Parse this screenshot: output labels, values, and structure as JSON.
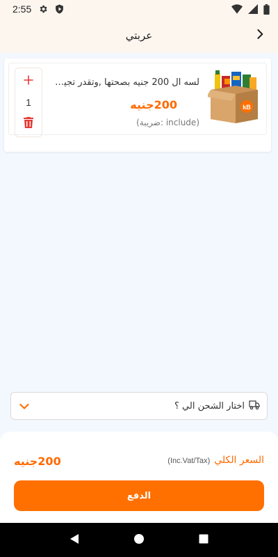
{
  "status_bar": {
    "time": "2:55",
    "icons": [
      "settings-icon",
      "shield-play-icon",
      "wifi-icon",
      "signal-icon",
      "battery-icon"
    ]
  },
  "app_bar": {
    "title": "عربتي",
    "back_icon": "chevron-right-icon"
  },
  "cart": {
    "items": [
      {
        "name": "لسه ال 200 جنيه بصحتها ,وتقدر تجيب...",
        "price": "200جنيه",
        "tax": "(include :ضريبة)",
        "quantity": "1",
        "image_icon": "grocery-box-image"
      }
    ]
  },
  "shipping": {
    "label": "اختار الشحن الي ؟",
    "icon": "shipping-icon",
    "dropdown_icon": "chevron-down-icon"
  },
  "summary": {
    "total_label": "السعر الكلي",
    "total_note": "(Inc.Vat/Tax)",
    "total_price": "200جنيه",
    "pay_label": "الدفع"
  },
  "colors": {
    "accent": "#ff7000",
    "price": "#ff6a00",
    "danger": "#e53935",
    "header_bg": "#fdf6ef",
    "page_bg": "#f3f7fe"
  }
}
